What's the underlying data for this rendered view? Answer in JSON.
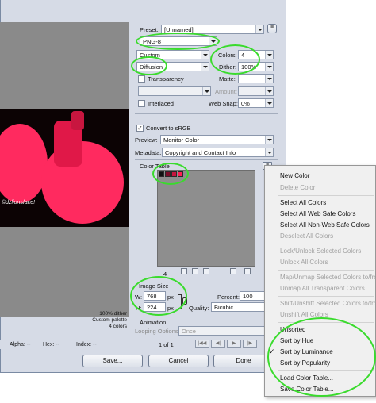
{
  "preview": {
    "caption": "©dzlionsface!",
    "info": [
      "100% dither",
      "Custom palette",
      "4 colors"
    ]
  },
  "status_bar": {
    "alpha": "Alpha: --",
    "hex": "Hex: --",
    "index": "Index: --"
  },
  "settings": {
    "preset_label": "Preset:",
    "preset_value": "[Unnamed]",
    "format": "PNG-8",
    "palette": "Custom",
    "colors_label": "Colors:",
    "colors_value": "4",
    "dither_algo": "Diffusion",
    "dither_label": "Dither:",
    "dither_value": "100%",
    "transparency_label": "Transparency",
    "matte_label": "Matte:",
    "amount_label": "Amount:",
    "interlaced_label": "Interlaced",
    "web_snap_label": "Web Snap:",
    "web_snap_value": "0%",
    "convert_srgb_label": "Convert to sRGB",
    "preview_label": "Preview:",
    "preview_value": "Monitor Color",
    "metadata_label": "Metadata:",
    "metadata_value": "Copyright and Contact Info",
    "color_table_label": "Color Table",
    "color_count": "4",
    "swatch_colors": [
      "#111111",
      "#7a0c28",
      "#c8163f",
      "#ff1e55"
    ]
  },
  "image_size": {
    "label": "Image Size",
    "w_label": "W:",
    "w_value": "768",
    "h_label": "H:",
    "h_value": "224",
    "unit": "px",
    "percent_label": "Percent:",
    "percent_value": "100",
    "quality_label": "Quality:",
    "quality_value": "Bicubic"
  },
  "animation": {
    "label": "Animation",
    "looping_label": "Looping Options:",
    "looping_value": "Once",
    "frame_counter": "1 of 1"
  },
  "buttons": {
    "save": "Save...",
    "cancel": "Cancel",
    "done": "Done"
  },
  "menu": {
    "items": [
      {
        "label": "New Color",
        "enabled": true
      },
      {
        "label": "Delete Color",
        "enabled": false
      },
      {
        "label": "Select All Colors",
        "enabled": true
      },
      {
        "label": "Select All Web Safe Colors",
        "enabled": true
      },
      {
        "label": "Select All Non-Web Safe Colors",
        "enabled": true
      },
      {
        "label": "Deselect All Colors",
        "enabled": false
      },
      {
        "label": "Lock/Unlock Selected Colors",
        "enabled": false
      },
      {
        "label": "Unlock All Colors",
        "enabled": false
      },
      {
        "label": "Map/Unmap Selected Colors to/from",
        "enabled": false
      },
      {
        "label": "Unmap All Transparent Colors",
        "enabled": false
      },
      {
        "label": "Shift/Unshift Selected Colors to/from",
        "enabled": false
      },
      {
        "label": "Unshift All Colors",
        "enabled": false
      },
      {
        "label": "Unsorted",
        "enabled": true
      },
      {
        "label": "Sort by Hue",
        "enabled": true
      },
      {
        "label": "Sort by Luminance",
        "enabled": true
      },
      {
        "label": "Sort by Popularity",
        "enabled": true
      },
      {
        "label": "Load Color Table...",
        "enabled": true
      },
      {
        "label": "Save Color Table...",
        "enabled": true
      }
    ],
    "checked_item": "Sort by Luminance"
  },
  "colors": {
    "highlight_ring": "#3adb2d",
    "photo_accent": "#ff2a5f"
  }
}
